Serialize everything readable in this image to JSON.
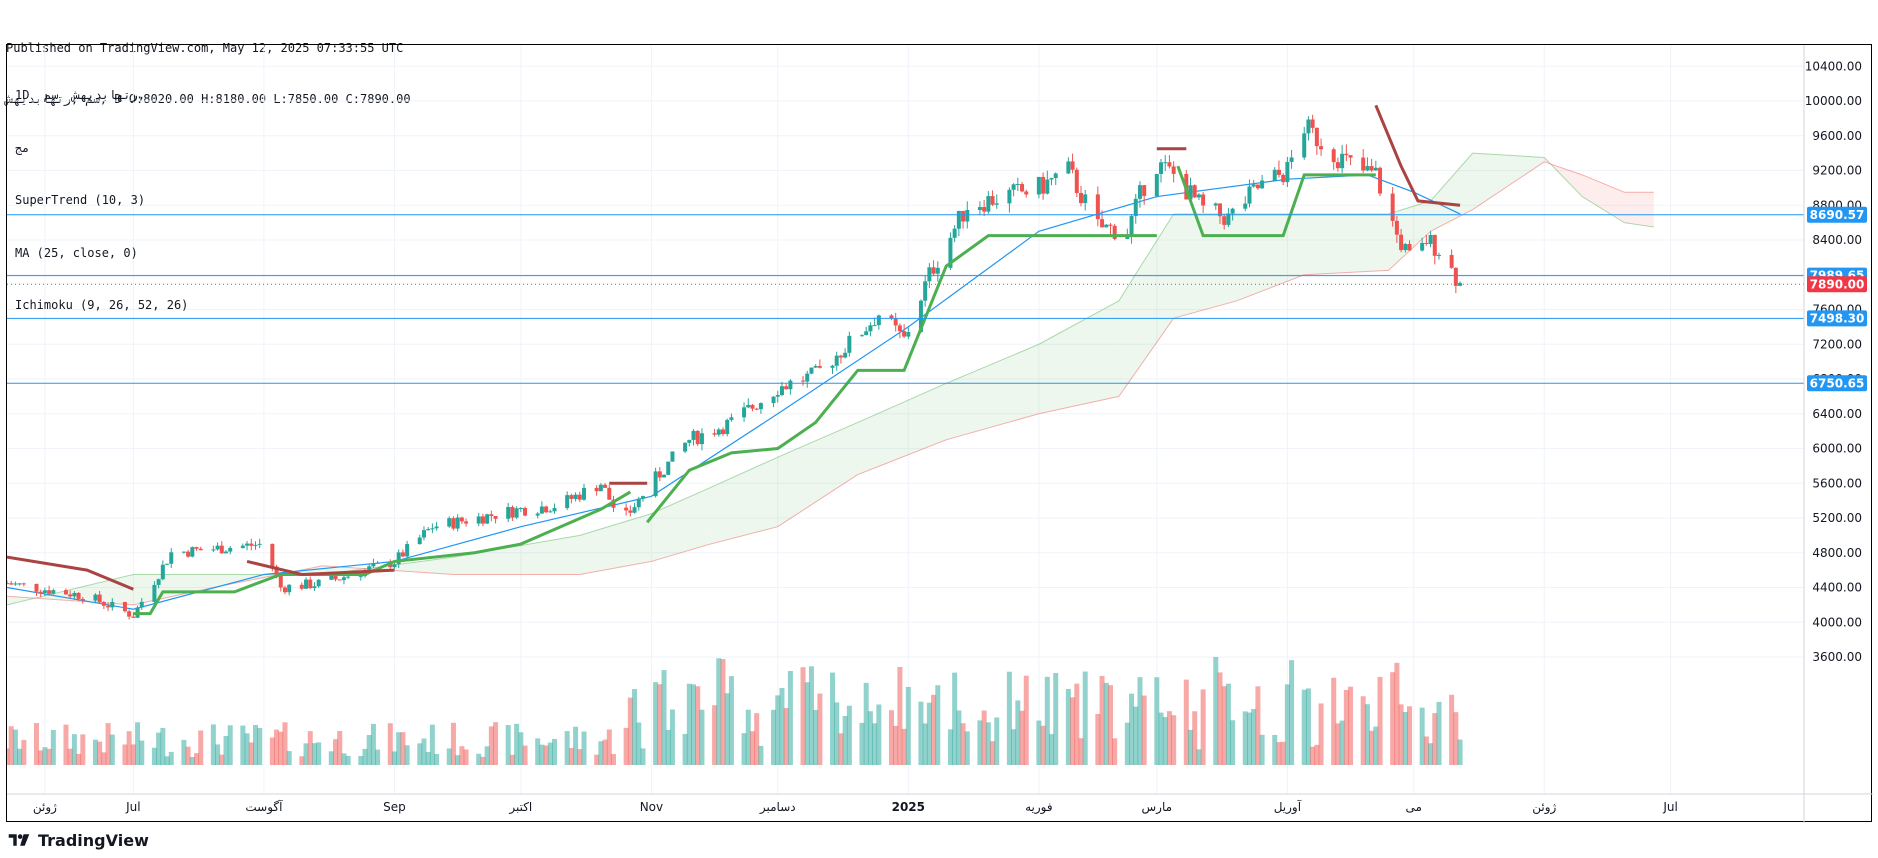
{
  "header": {
    "published_line": "Published on TradingView.com, May 12, 2025 07:33:55 UTC",
    "ohlc_line": "سم ,رتهابديهش, D O:8020.00 H:8180.00 L:7850.00 C:7890.00"
  },
  "legend": {
    "symbol_line": "1D  رتهابديهش  سم,",
    "exchange": "مج",
    "supertrend": "SuperTrend (10, 3)",
    "ma": "MA (25, close, 0)",
    "ichimoku": "Ichimoku (9, 26, 52, 26)"
  },
  "footer": {
    "brand": "TradingView"
  },
  "colors": {
    "up": "#26a69a",
    "down": "#ef5350",
    "supertrend_up": "#4caf50",
    "supertrend_down": "#a94442",
    "ma": "#2196f3",
    "hline": "#2196f3",
    "last_price": "#f23645",
    "cloud_bull": "#4caf50",
    "cloud_bear": "#ef5350"
  },
  "chart_data": {
    "type": "candlestick",
    "y_axis": {
      "ylim": [
        3400,
        10800
      ],
      "position": "right",
      "ticks": [
        3600,
        4000,
        4400,
        4800,
        5200,
        5600,
        6000,
        6400,
        6800,
        7200,
        7600,
        8000,
        8400,
        8800,
        9200,
        9600,
        10000,
        10400
      ]
    },
    "x_axis": {
      "date_range": [
        "2024-06-01",
        "2025-07-31"
      ],
      "labels": [
        {
          "text": "ژوئن",
          "date": "2024-06-10"
        },
        {
          "text": "Jul",
          "date": "2024-07-01"
        },
        {
          "text": "آگوست",
          "date": "2024-08-01"
        },
        {
          "text": "Sep",
          "date": "2024-09-01"
        },
        {
          "text": "اکتبر",
          "date": "2024-10-01"
        },
        {
          "text": "Nov",
          "date": "2024-11-01"
        },
        {
          "text": "دسامبر",
          "date": "2024-12-01"
        },
        {
          "text": "2025",
          "date": "2025-01-01"
        },
        {
          "text": "فوریه",
          "date": "2025-02-01"
        },
        {
          "text": "مارس",
          "date": "2025-03-01"
        },
        {
          "text": "آوریل",
          "date": "2025-04-01"
        },
        {
          "text": "می",
          "date": "2025-05-01"
        },
        {
          "text": "ژوئن",
          "date": "2025-06-01"
        },
        {
          "text": "Jul",
          "date": "2025-07-01"
        }
      ]
    },
    "price_lines": [
      {
        "value": 8690.57,
        "label": "8690.57"
      },
      {
        "value": 7989.65,
        "label": "7989.65"
      },
      {
        "value": 7498.3,
        "label": "7498.30"
      },
      {
        "value": 6750.65,
        "label": "6750.65"
      }
    ],
    "last_price": {
      "value": 7890.0,
      "label": "7890.00"
    },
    "price_anchors": [
      [
        "2024-06-01",
        4450
      ],
      [
        "2024-06-20",
        4300
      ],
      [
        "2024-07-01",
        4080
      ],
      [
        "2024-07-10",
        4800
      ],
      [
        "2024-08-01",
        4900
      ],
      [
        "2024-08-05",
        4400
      ],
      [
        "2024-08-15",
        4450
      ],
      [
        "2024-09-01",
        4700
      ],
      [
        "2024-09-10",
        5100
      ],
      [
        "2024-10-01",
        5300
      ],
      [
        "2024-10-10",
        5350
      ],
      [
        "2024-10-20",
        5600
      ],
      [
        "2024-10-25",
        5150
      ],
      [
        "2024-11-01",
        5600
      ],
      [
        "2024-11-10",
        6100
      ],
      [
        "2024-11-20",
        6300
      ],
      [
        "2024-12-01",
        6700
      ],
      [
        "2024-12-10",
        6850
      ],
      [
        "2024-12-20",
        7300
      ],
      [
        "2024-12-25",
        7550
      ],
      [
        "2024-12-31",
        7250
      ],
      [
        "2025-01-06",
        8000
      ],
      [
        "2025-01-15",
        8800
      ],
      [
        "2025-02-01",
        9000
      ],
      [
        "2025-02-08",
        9200
      ],
      [
        "2025-02-15",
        8550
      ],
      [
        "2025-02-22",
        8500
      ],
      [
        "2025-02-28",
        9300
      ],
      [
        "2025-03-05",
        9150
      ],
      [
        "2025-03-12",
        8750
      ],
      [
        "2025-03-18",
        8650
      ],
      [
        "2025-03-25",
        9000
      ],
      [
        "2025-04-01",
        9200
      ],
      [
        "2025-04-05",
        9700
      ],
      [
        "2025-04-12",
        9400
      ],
      [
        "2025-04-18",
        9200
      ],
      [
        "2025-04-22",
        9150
      ],
      [
        "2025-04-27",
        8450
      ],
      [
        "2025-05-01",
        8100
      ],
      [
        "2025-05-04",
        8400
      ],
      [
        "2025-05-07",
        8300
      ],
      [
        "2025-05-12",
        7890
      ]
    ],
    "supertrend": {
      "up": [
        [
          [
            "2024-07-01",
            4100
          ],
          [
            "2024-07-05",
            4100
          ],
          [
            "2024-07-08",
            4350
          ],
          [
            "2024-07-25",
            4350
          ],
          [
            "2024-08-05",
            4550
          ],
          [
            "2024-08-25",
            4550
          ],
          [
            "2024-09-01",
            4700
          ],
          [
            "2024-09-20",
            4800
          ],
          [
            "2024-10-01",
            4900
          ],
          [
            "2024-10-20",
            5300
          ],
          [
            "2024-10-27",
            5500
          ]
        ],
        [
          [
            "2024-10-31",
            5150
          ],
          [
            "2024-11-05",
            5450
          ],
          [
            "2024-11-10",
            5750
          ],
          [
            "2024-11-20",
            5950
          ],
          [
            "2024-12-01",
            6000
          ],
          [
            "2024-12-10",
            6300
          ],
          [
            "2024-12-20",
            6900
          ],
          [
            "2024-12-31",
            6900
          ],
          [
            "2025-01-10",
            8100
          ],
          [
            "2025-01-20",
            8450
          ],
          [
            "2025-03-01",
            8450
          ]
        ],
        [
          [
            "2025-03-06",
            9250
          ],
          [
            "2025-03-12",
            8450
          ],
          [
            "2025-03-31",
            8450
          ],
          [
            "2025-04-05",
            9150
          ],
          [
            "2025-04-22",
            9150
          ]
        ]
      ],
      "down": [
        [
          [
            "2024-06-01",
            4750
          ],
          [
            "2024-06-20",
            4600
          ],
          [
            "2024-07-01",
            4380
          ]
        ],
        [
          [
            "2024-07-28",
            4700
          ],
          [
            "2024-08-10",
            4550
          ],
          [
            "2024-09-01",
            4600
          ]
        ],
        [
          [
            "2024-10-22",
            5600
          ],
          [
            "2024-10-31",
            5600
          ]
        ],
        [
          [
            "2025-03-01",
            9450
          ],
          [
            "2025-03-08",
            9450
          ]
        ],
        [
          [
            "2025-04-22",
            9950
          ],
          [
            "2025-04-28",
            9250
          ],
          [
            "2025-05-02",
            8850
          ],
          [
            "2025-05-12",
            8800
          ]
        ]
      ]
    },
    "ma": [
      [
        "2024-06-01",
        4400
      ],
      [
        "2024-07-01",
        4150
      ],
      [
        "2024-08-01",
        4550
      ],
      [
        "2024-09-01",
        4700
      ],
      [
        "2024-10-01",
        5100
      ],
      [
        "2024-11-01",
        5450
      ],
      [
        "2024-12-01",
        6400
      ],
      [
        "2025-01-01",
        7400
      ],
      [
        "2025-02-01",
        8500
      ],
      [
        "2025-03-01",
        8900
      ],
      [
        "2025-04-01",
        9100
      ],
      [
        "2025-04-20",
        9150
      ],
      [
        "2025-05-01",
        8950
      ],
      [
        "2025-05-12",
        8700
      ]
    ],
    "ichimoku": {
      "cloud": [
        [
          "2024-06-01",
          4200,
          4300
        ],
        [
          "2024-07-01",
          4550,
          4200
        ],
        [
          "2024-07-20",
          4550,
          4400
        ],
        [
          "2024-08-15",
          4550,
          4650
        ],
        [
          "2024-09-15",
          4750,
          4550
        ],
        [
          "2024-10-15",
          5000,
          4550
        ],
        [
          "2024-11-01",
          5250,
          4700
        ],
        [
          "2024-11-15",
          5550,
          4900
        ],
        [
          "2024-12-01",
          5900,
          5100
        ],
        [
          "2024-12-20",
          6300,
          5700
        ],
        [
          "2025-01-10",
          6750,
          6100
        ],
        [
          "2025-02-01",
          7200,
          6400
        ],
        [
          "2025-02-20",
          7700,
          6600
        ],
        [
          "2025-03-05",
          8700,
          7500
        ],
        [
          "2025-03-20",
          8700,
          7700
        ],
        [
          "2025-04-05",
          8700,
          8000
        ],
        [
          "2025-04-25",
          8700,
          8050
        ],
        [
          "2025-05-05",
          8850,
          8500
        ],
        [
          "2025-05-15",
          9400,
          8750
        ],
        [
          "2025-06-01",
          9350,
          9300
        ],
        [
          "2025-06-10",
          8900,
          9150
        ],
        [
          "2025-06-20",
          8600,
          8950
        ],
        [
          "2025-06-27",
          8550,
          8950
        ]
      ]
    },
    "volume": {
      "max_value": 100,
      "note": "relative bar heights"
    }
  }
}
